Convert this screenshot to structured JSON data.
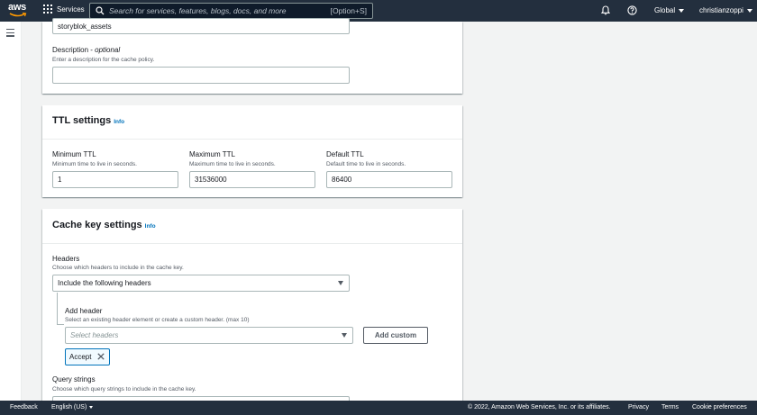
{
  "nav": {
    "logo_text": "aws",
    "services_label": "Services",
    "search_placeholder": "Search for services, features, blogs, docs, and more",
    "search_shortcut": "[Option+S]",
    "region": "Global",
    "account": "christianzoppi"
  },
  "general": {
    "name_value": "storyblok_assets",
    "description_label": "Description - ",
    "description_optional": "optional",
    "description_desc": "Enter a description for the cache policy.",
    "description_value": ""
  },
  "ttl": {
    "title": "TTL settings",
    "info": "Info",
    "min_label": "Minimum TTL",
    "min_desc": "Minimum time to live in seconds.",
    "min_value": "1",
    "max_label": "Maximum TTL",
    "max_desc": "Maximum time to live in seconds.",
    "max_value": "31536000",
    "default_label": "Default TTL",
    "default_desc": "Default time to live in seconds.",
    "default_value": "86400"
  },
  "cache_key": {
    "title": "Cache key settings",
    "info": "Info",
    "headers_label": "Headers",
    "headers_desc": "Choose which headers to include in the cache key.",
    "headers_selected": "Include the following headers",
    "add_header_label": "Add header",
    "add_header_desc": "Select an existing header element or create a custom header. (max 10)",
    "select_headers_placeholder": "Select headers",
    "add_custom_button": "Add custom",
    "tokens": [
      "Accept"
    ],
    "query_label": "Query strings",
    "query_desc": "Choose which query strings to include in the cache key."
  },
  "footer": {
    "feedback": "Feedback",
    "language": "English (US)",
    "copyright": "© 2022, Amazon Web Services, Inc. or its affiliates.",
    "privacy": "Privacy",
    "terms": "Terms",
    "cookies": "Cookie preferences"
  },
  "colors": {
    "nav_bg": "#232f3e",
    "accent": "#0073bb",
    "aws_orange": "#ff9900"
  }
}
